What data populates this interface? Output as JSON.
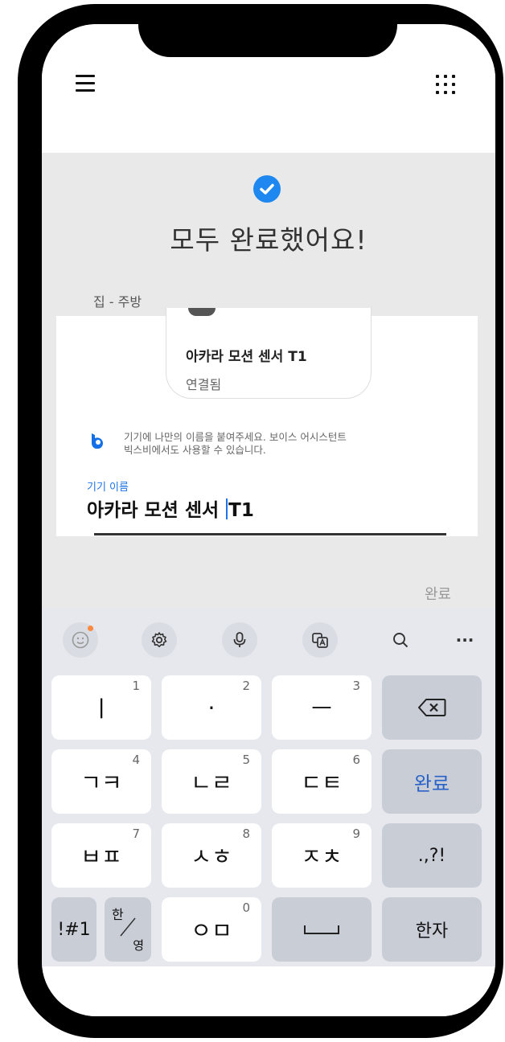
{
  "content": {
    "title": "모두 완료했어요!",
    "section_label": "집 - 주방",
    "device": {
      "name": "아카라 모션 센서 T1",
      "status": "연결됨"
    },
    "hint_line1": "기기에 나만의 이름을 붙여주세요. 보이스 어시스턴트",
    "hint_line2": "빅스비에서도 사용할 수 있습니다.",
    "field_label": "기기 이름",
    "field_value_before": "아카라 모션 센서 ",
    "field_value_after": "T1",
    "done_label": "완료"
  },
  "keyboard": {
    "toolbar_more": "···",
    "keys": [
      {
        "id": "k1",
        "label": "ㅣ",
        "num": "1"
      },
      {
        "id": "k2",
        "label": "·",
        "num": "2"
      },
      {
        "id": "k3",
        "label": "ㅡ",
        "num": "3"
      },
      {
        "id": "k4",
        "label": "ㄱㅋ",
        "num": "4"
      },
      {
        "id": "k5",
        "label": "ㄴㄹ",
        "num": "5"
      },
      {
        "id": "k6",
        "label": "ㄷㅌ",
        "num": "6"
      },
      {
        "id": "k7",
        "label": "ㅂㅍ",
        "num": "7"
      },
      {
        "id": "k8",
        "label": "ㅅㅎ",
        "num": "8"
      },
      {
        "id": "k9",
        "label": "ㅈㅊ",
        "num": "9"
      },
      {
        "id": "k0",
        "label": "ㅇㅁ",
        "num": "0"
      }
    ],
    "done_key": "완료",
    "punct_key": ".,?!",
    "symbols_key": "!#1",
    "lang_key_top": "한",
    "lang_key_bottom": "영",
    "hanja_key": "한자"
  },
  "colors": {
    "accent": "#1e88f0",
    "keyboard_bg": "#e6e8ee",
    "function_key": "#c9cdd6"
  }
}
